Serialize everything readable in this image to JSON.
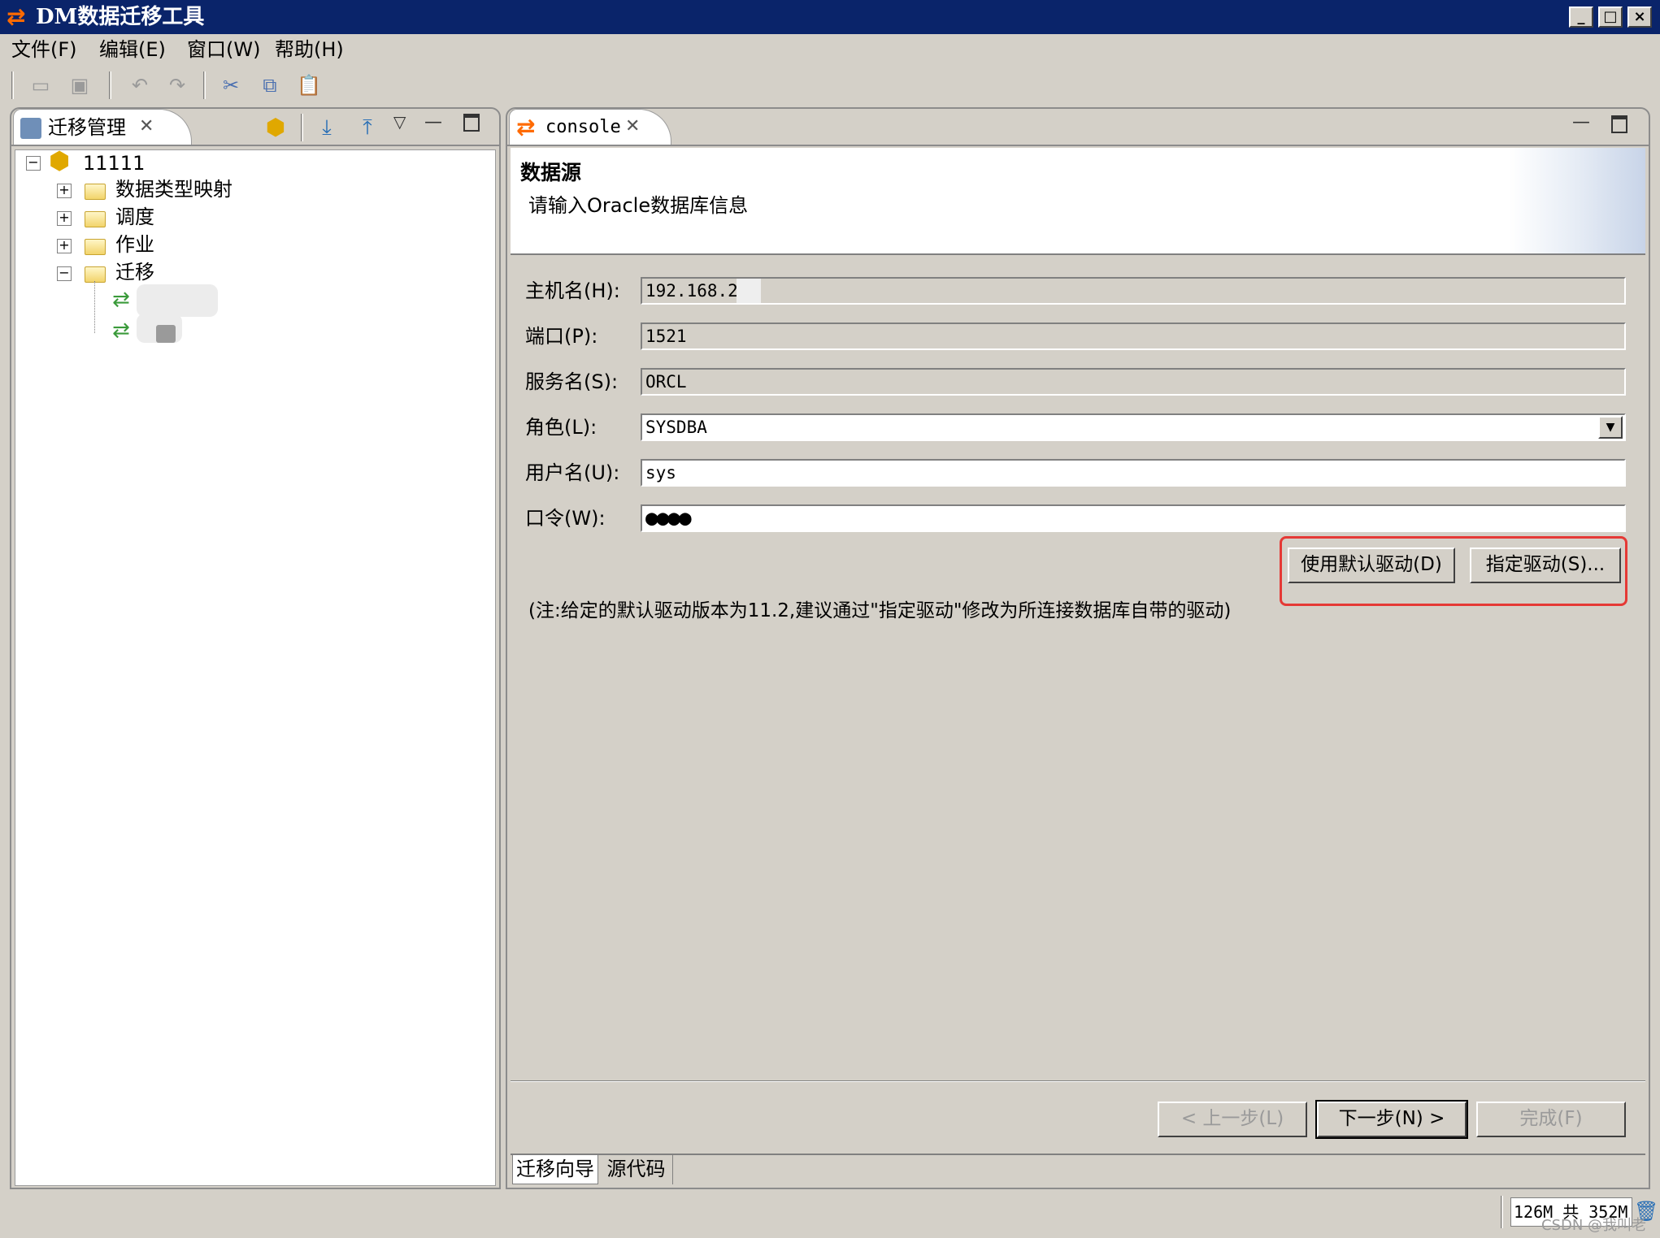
{
  "window": {
    "title": "DM数据迁移工具",
    "icon": "swap-arrows-icon",
    "buttons": [
      "minimize",
      "maximize",
      "close"
    ]
  },
  "menu": [
    "文件(F)",
    "编辑(E)",
    "窗口(W)",
    "帮助(H)"
  ],
  "toolbar": [
    "save-icon",
    "save-all-icon",
    "undo-icon",
    "redo-icon",
    "cut-icon",
    "copy-icon",
    "paste-icon"
  ],
  "left_panel": {
    "tab_label": "迁移管理",
    "tree": {
      "root": "11111",
      "children": [
        "数据类型映射",
        "调度",
        "作业",
        "迁移"
      ]
    }
  },
  "right_panel": {
    "tab_label": "console",
    "header_title": "数据源",
    "header_desc": "请输入Oracle数据库信息",
    "fields": {
      "host": {
        "label": "主机名(H):",
        "value": "192.168.2"
      },
      "port": {
        "label": "端口(P):",
        "value": "1521"
      },
      "service": {
        "label": "服务名(S):",
        "value": "ORCL"
      },
      "role": {
        "label": "角色(L):",
        "value": "SYSDBA"
      },
      "user": {
        "label": "用户名(U):",
        "value": "sys"
      },
      "password": {
        "label": "口令(W):",
        "value": "●●●●"
      }
    },
    "default_driver_button": "使用默认驱动(D)",
    "specify_driver_button": "指定驱动(S)...",
    "note": "(注:给定的默认驱动版本为11.2,建议通过\"指定驱动\"修改为所连接数据库自带的驱动)",
    "prev_button": "< 上一步(L)",
    "next_button": "下一步(N) >",
    "finish_button": "完成(F)",
    "bottom_tabs": [
      "迁移向导",
      "源代码"
    ]
  },
  "status": {
    "memory": "126M 共 352M",
    "watermark": "CSDN @我叫老"
  },
  "colors": {
    "titlebar": "#0a246a",
    "highlight_box": "#e53935",
    "panel_bg": "#d4d0c8"
  }
}
